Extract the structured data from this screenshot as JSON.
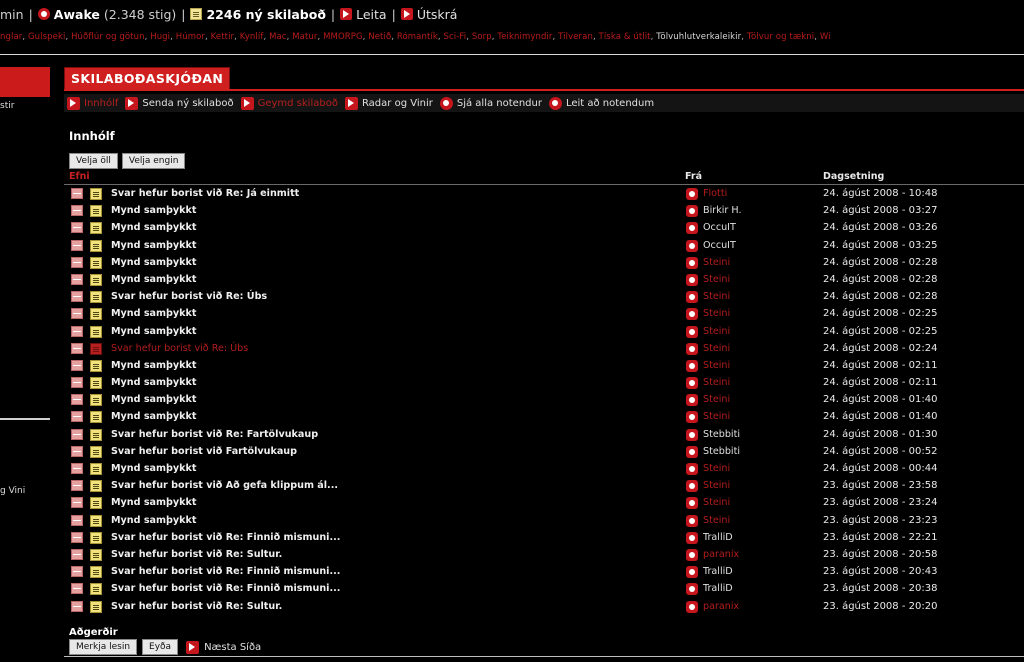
{
  "topbar": {
    "user_fragment": "min",
    "user_name": "Awake",
    "user_points": "(2.348 stig)",
    "messages_label": "2246 ný skilaboð",
    "search_label": "Leita",
    "logout_label": "Útskrá"
  },
  "categories": [
    {
      "label": "nglar",
      "white": false
    },
    {
      "label": "Gulspeki",
      "white": false
    },
    {
      "label": "Húðflúr og götun",
      "white": false
    },
    {
      "label": "Hugi",
      "white": false
    },
    {
      "label": "Húmor",
      "white": false
    },
    {
      "label": "Kettir",
      "white": false
    },
    {
      "label": "Kynlíf",
      "white": false
    },
    {
      "label": "Mac",
      "white": false
    },
    {
      "label": "Matur",
      "white": false
    },
    {
      "label": "MMORPG",
      "white": false
    },
    {
      "label": "Netið",
      "white": false
    },
    {
      "label": "Rómantík",
      "white": false
    },
    {
      "label": "Sci-Fi",
      "white": false
    },
    {
      "label": "Sorp",
      "white": false
    },
    {
      "label": "Teiknimyndir",
      "white": false
    },
    {
      "label": "Tilveran",
      "white": false
    },
    {
      "label": "Tíska & útlit",
      "white": false
    },
    {
      "label": "Tölvuhlutverkaleikir",
      "white": true
    },
    {
      "label": "Tölvur og tækni",
      "white": false
    },
    {
      "label": "Wi",
      "white": false
    }
  ],
  "left": {
    "fragment_top": "stir",
    "fragment_bottom": "g Vini"
  },
  "page": {
    "title": "SKILABOÐASKJÓÐAN",
    "box_title": "Innhólf"
  },
  "nav": [
    {
      "label": "Innhólf",
      "red": true
    },
    {
      "label": "Senda ný skilaboð",
      "red": false
    },
    {
      "label": "Geymd skilaboð",
      "red": true
    },
    {
      "label": "Radar og Vinir",
      "red": false
    },
    {
      "label": "Sjá alla notendur",
      "red": false
    },
    {
      "label": "Leit að notendum",
      "red": false
    }
  ],
  "buttons": {
    "select_all": "Velja öll",
    "select_none": "Velja engin"
  },
  "table": {
    "col_subject": "Efni",
    "col_from": "Frá",
    "col_date": "Dagsetning",
    "rows": [
      {
        "subject": "Svar hefur borist við Re: Já einmitt",
        "from": "Flotti",
        "date": "24. ágúst 2008 - 10:48",
        "from_red": true,
        "unread": false
      },
      {
        "subject": "Mynd samþykkt",
        "from": "Birkir H.",
        "date": "24. ágúst 2008 - 03:27",
        "from_red": false,
        "unread": false
      },
      {
        "subject": "Mynd samþykkt",
        "from": "OccuIT",
        "date": "24. ágúst 2008 - 03:26",
        "from_red": false,
        "unread": false
      },
      {
        "subject": "Mynd samþykkt",
        "from": "OccuIT",
        "date": "24. ágúst 2008 - 03:25",
        "from_red": false,
        "unread": false
      },
      {
        "subject": "Mynd samþykkt",
        "from": "Steini",
        "date": "24. ágúst 2008 - 02:28",
        "from_red": true,
        "unread": false
      },
      {
        "subject": "Mynd samþykkt",
        "from": "Steini",
        "date": "24. ágúst 2008 - 02:28",
        "from_red": true,
        "unread": false
      },
      {
        "subject": "Svar hefur borist við Re: Úbs",
        "from": "Steini",
        "date": "24. ágúst 2008 - 02:28",
        "from_red": true,
        "unread": false
      },
      {
        "subject": "Mynd samþykkt",
        "from": "Steini",
        "date": "24. ágúst 2008 - 02:25",
        "from_red": true,
        "unread": false
      },
      {
        "subject": "Mynd samþykkt",
        "from": "Steini",
        "date": "24. ágúst 2008 - 02:25",
        "from_red": true,
        "unread": false
      },
      {
        "subject": "Svar hefur borist við Re: Úbs",
        "from": "Steini",
        "date": "24. ágúst 2008 - 02:24",
        "from_red": true,
        "unread": true
      },
      {
        "subject": "Mynd samþykkt",
        "from": "Steini",
        "date": "24. ágúst 2008 - 02:11",
        "from_red": true,
        "unread": false
      },
      {
        "subject": "Mynd samþykkt",
        "from": "Steini",
        "date": "24. ágúst 2008 - 02:11",
        "from_red": true,
        "unread": false
      },
      {
        "subject": "Mynd samþykkt",
        "from": "Steini",
        "date": "24. ágúst 2008 - 01:40",
        "from_red": true,
        "unread": false
      },
      {
        "subject": "Mynd samþykkt",
        "from": "Steini",
        "date": "24. ágúst 2008 - 01:40",
        "from_red": true,
        "unread": false
      },
      {
        "subject": "Svar hefur borist við Re: Fartölvukaup",
        "from": "Stebbiti",
        "date": "24. ágúst 2008 - 01:30",
        "from_red": false,
        "unread": false
      },
      {
        "subject": "Svar hefur borist við Fartölvukaup",
        "from": "Stebbiti",
        "date": "24. ágúst 2008 - 00:52",
        "from_red": false,
        "unread": false
      },
      {
        "subject": "Mynd samþykkt",
        "from": "Steini",
        "date": "24. ágúst 2008 - 00:44",
        "from_red": true,
        "unread": false
      },
      {
        "subject": "Svar hefur borist við Að gefa klippum ál...",
        "from": "Steini",
        "date": "23. ágúst 2008 - 23:58",
        "from_red": true,
        "unread": false
      },
      {
        "subject": "Mynd samþykkt",
        "from": "Steini",
        "date": "23. ágúst 2008 - 23:24",
        "from_red": true,
        "unread": false
      },
      {
        "subject": "Mynd samþykkt",
        "from": "Steini",
        "date": "23. ágúst 2008 - 23:23",
        "from_red": true,
        "unread": false
      },
      {
        "subject": "Svar hefur borist við Re: Finnið mismuni...",
        "from": "TralliD",
        "date": "23. ágúst 2008 - 22:21",
        "from_red": false,
        "unread": false
      },
      {
        "subject": "Svar hefur borist við Re: Sultur.",
        "from": "paranix",
        "date": "23. ágúst 2008 - 20:58",
        "from_red": true,
        "unread": false
      },
      {
        "subject": "Svar hefur borist við Re: Finnið mismuni...",
        "from": "TralliD",
        "date": "23. ágúst 2008 - 20:43",
        "from_red": false,
        "unread": false
      },
      {
        "subject": "Svar hefur borist við Re: Finnið mismuni...",
        "from": "TralliD",
        "date": "23. ágúst 2008 - 20:38",
        "from_red": false,
        "unread": false
      },
      {
        "subject": "Svar hefur borist við Re: Sultur.",
        "from": "paranix",
        "date": "23. ágúst 2008 - 20:20",
        "from_red": true,
        "unread": false
      }
    ]
  },
  "actions": {
    "title": "Aðgerðir",
    "mark_read": "Merkja lesin",
    "delete": "Eyða",
    "next_page": "Næsta Síða"
  }
}
